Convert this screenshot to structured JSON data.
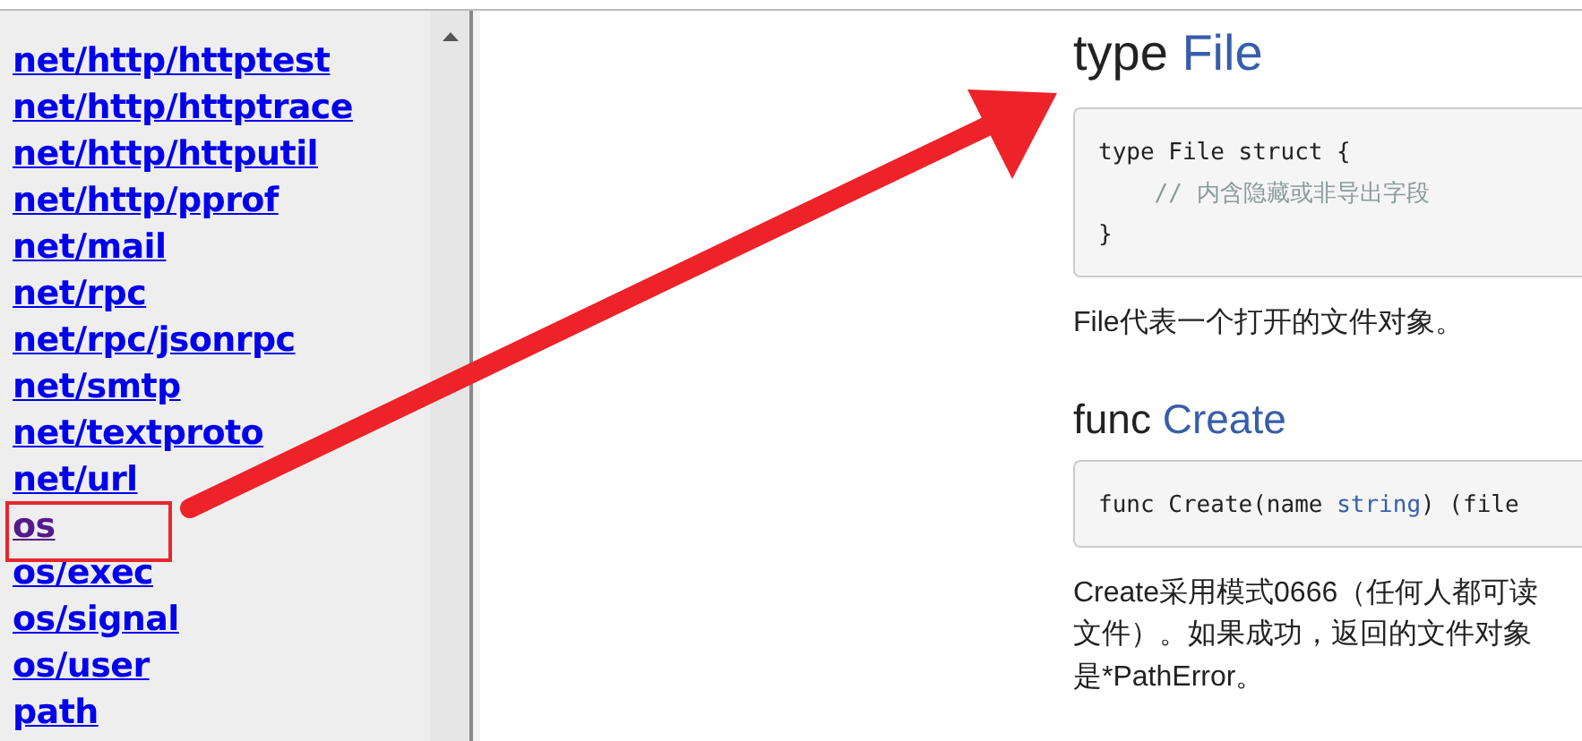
{
  "sidebar": {
    "items": [
      {
        "label": "net/http/httptest",
        "visited": false
      },
      {
        "label": "net/http/httptrace",
        "visited": false
      },
      {
        "label": "net/http/httputil",
        "visited": false
      },
      {
        "label": "net/http/pprof",
        "visited": false
      },
      {
        "label": "net/mail",
        "visited": false
      },
      {
        "label": "net/rpc",
        "visited": false
      },
      {
        "label": "net/rpc/jsonrpc",
        "visited": false
      },
      {
        "label": "net/smtp",
        "visited": false
      },
      {
        "label": "net/textproto",
        "visited": false
      },
      {
        "label": "net/url",
        "visited": false
      },
      {
        "label": "os",
        "visited": true
      },
      {
        "label": "os/exec",
        "visited": false
      },
      {
        "label": "os/signal",
        "visited": false
      },
      {
        "label": "os/user",
        "visited": false
      },
      {
        "label": "path",
        "visited": false
      }
    ]
  },
  "content": {
    "sections": [
      {
        "keyword": "type",
        "name": "File",
        "code": [
          [
            {
              "text": "type File struct {",
              "kind": "plain"
            }
          ],
          [
            {
              "text": "    // 内含隐藏或非导出字段",
              "kind": "comment"
            }
          ],
          [
            {
              "text": "}",
              "kind": "plain"
            }
          ]
        ],
        "description": [
          "File代表一个打开的文件对象。"
        ]
      },
      {
        "keyword": "func",
        "name": "Create",
        "code": [
          [
            {
              "text": "func Create(name ",
              "kind": "plain"
            },
            {
              "text": "string",
              "kind": "type"
            },
            {
              "text": ") (file",
              "kind": "plain"
            }
          ]
        ],
        "description": [
          "Create采用模式0666（任何人都可读",
          "文件）。如果成功，返回的文件对象",
          "是*PathError。"
        ]
      }
    ]
  }
}
